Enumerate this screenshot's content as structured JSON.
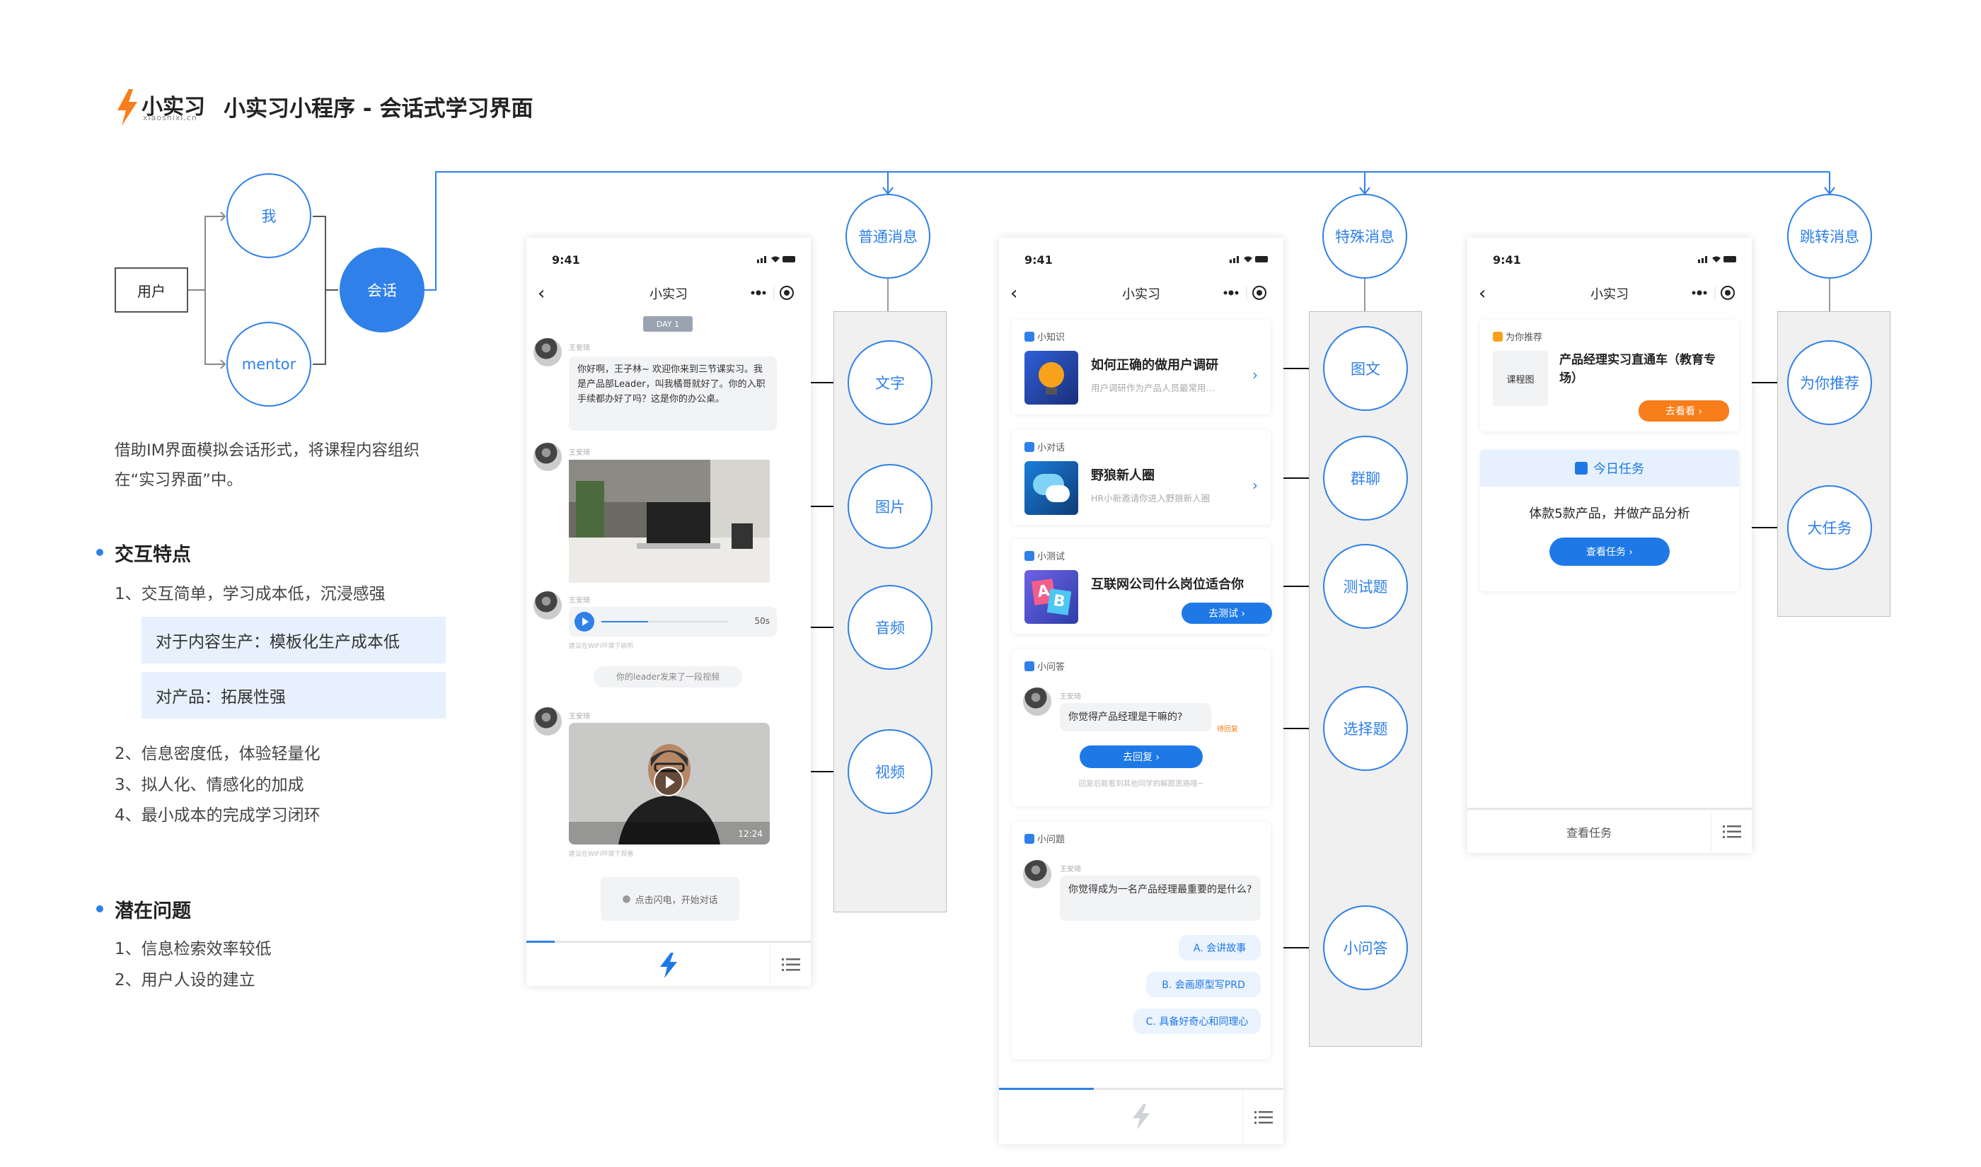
{
  "header": {
    "logo_text": "小实习",
    "logo_sub": "xiaoshixi.cn",
    "title": "小实习小程序 - 会话式学习界面"
  },
  "flow": {
    "user": "用户",
    "me": "我",
    "mentor": "mentor",
    "session": "会话"
  },
  "description": "借助IM界面模拟会话形式，将课程内容组织在“实习界面”中。",
  "features": {
    "title": "交互特点",
    "item1": "1、交互简单，学习成本低，沉浸感强",
    "box1": "对于内容生产：模板化生产成本低",
    "box2": "对产品：拓展性强",
    "item2": "2、信息密度低，体验轻量化",
    "item3": "3、拟人化、情感化的加成",
    "item4": "4、最小成本的完成学习闭环"
  },
  "issues": {
    "title": "潜在问题",
    "item1": "1、信息检索效率较低",
    "item2": "2、用户人设的建立"
  },
  "categories": {
    "normal": "普通消息",
    "special": "特殊消息",
    "jump": "跳转消息"
  },
  "normal_types": {
    "text": "文字",
    "image": "图片",
    "audio": "音频",
    "video": "视频"
  },
  "special_types": {
    "rich": "图文",
    "group": "群聊",
    "quiz": "测试题",
    "choice": "选择题",
    "qa": "小问答"
  },
  "jump_types": {
    "recommend": "为你推荐",
    "task": "大任务"
  },
  "phone_common": {
    "time": "9:41",
    "title": "小实习"
  },
  "phone1": {
    "day": "DAY 1",
    "sender": "王安琦",
    "text_msg": "你好啊，王子林~ 欢迎你来到三节课实习。我是产品部Leader，叫我橘哥就好了。你的入职手续都办好了吗？这是你的办公桌。",
    "audio_len": "50s",
    "audio_note": "建议在WIFI环境下收听",
    "system_msg": "你的leader发来了一段视频",
    "video_len": "12:24",
    "video_note": "建议在WIFI环境下观看",
    "start_hint": "点击闪电，开始对话"
  },
  "phone2": {
    "c1_cat": "小知识",
    "c1_title": "如何正确的做用户调研",
    "c1_sub": "用户调研作为产品人员最常用…",
    "c2_cat": "小对话",
    "c2_title": "野狼新人圈",
    "c2_sub": "HR小新邀请你进入野狼新人圈",
    "c3_cat": "小测试",
    "c3_title": "互联网公司什么岗位适合你",
    "c3_btn": "去测试 ›",
    "c4_cat": "小问答",
    "c4_sender": "王安琦",
    "c4_q": "你觉得产品经理是干嘛的?",
    "c4_badge": "待回复",
    "c4_btn": "去回复 ›",
    "c4_note": "回复后能看到其他同学的解题思路哦~",
    "c5_cat": "小问题",
    "c5_sender": "王安琦",
    "c5_q": "你觉得成为一名产品经理最重要的是什么?",
    "opt_a": "A. 会讲故事",
    "opt_b": "B. 会画原型写PRD",
    "opt_c": "C. 具备好奇心和同理心"
  },
  "phone3": {
    "rec_label": "为你推荐",
    "rec_thumb": "课程图",
    "rec_title": "产品经理实习直通车（教育专场）",
    "rec_btn": "去看看 ›",
    "task_header": "今日任务",
    "task_desc": "体款5款产品，并做产品分析",
    "task_btn": "查看任务 ›",
    "bottom_label": "查看任务"
  },
  "colors": {
    "accent": "#2f80e8",
    "orange": "#f77e1a",
    "panel": "#f0f0f0"
  }
}
